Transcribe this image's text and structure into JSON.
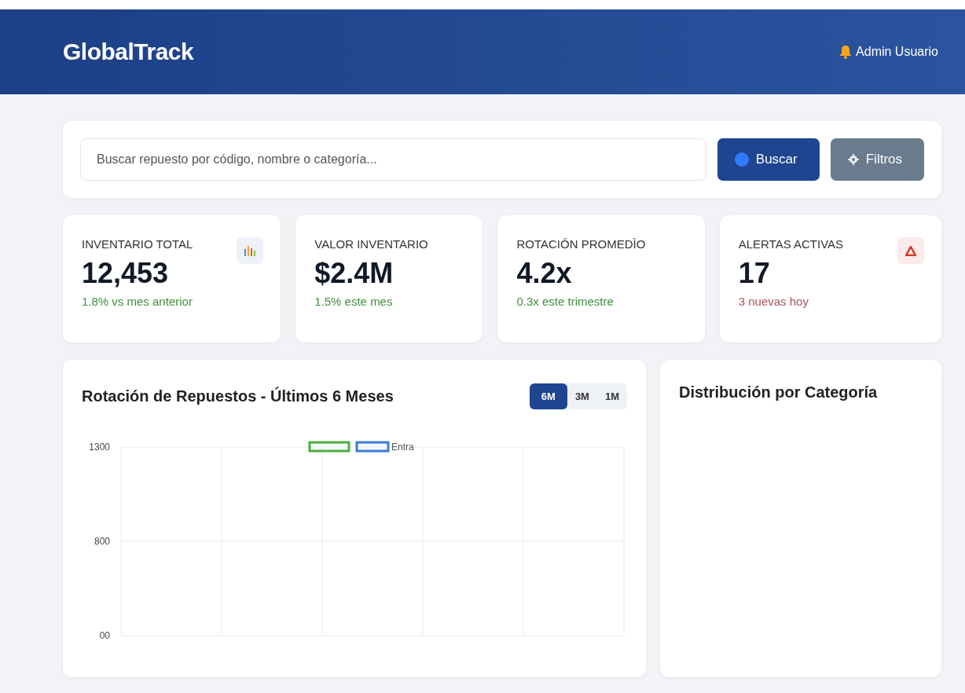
{
  "header": {
    "logo": "GlobalTrack",
    "user": "Admin Usuario"
  },
  "search": {
    "placeholder": "Buscar repuesto por código, nombre o categoría...",
    "buttons": [
      {
        "label": "Buscar",
        "kind": "primary"
      },
      {
        "label": "Filtros",
        "kind": "secondary"
      }
    ]
  },
  "stats": [
    {
      "label": "INVENTARIO TOTAL",
      "value": "12,453",
      "change": "1.8% vs mes anterior",
      "color": "#3f8f3b",
      "kind": "chart"
    },
    {
      "label": "VALOR INVENTARIO",
      "value": "$2.4M",
      "change": "1.5% este mes",
      "color": "#3f8f3b",
      "kind": "plain"
    },
    {
      "label": "ROTACIÓN PROMEDÌO",
      "value": "4.2x",
      "change": "0.3x este trimestre",
      "color": "#3f8f3b",
      "kind": "plain"
    },
    {
      "label": "ALERTAS ACTIVAS",
      "value": "17",
      "change": "3 nuevas hoy",
      "color": "#a9545a",
      "kind": "alert"
    }
  ],
  "rotation_panel": {
    "title": "Rotación de Repuestos - Últimos 6 Meses",
    "ranges": [
      {
        "label": "6M",
        "selected": true
      },
      {
        "label": "3M",
        "selected": false
      },
      {
        "label": "1M",
        "selected": false
      }
    ],
    "axis_labels": [
      "1300",
      "800",
      "00"
    ],
    "legend": [
      {
        "color": "#4caf3e"
      },
      {
        "label": "Entra",
        "color": "#3b7dd8"
      }
    ]
  },
  "category_panel": {
    "title": "Distribución por Categoría"
  }
}
